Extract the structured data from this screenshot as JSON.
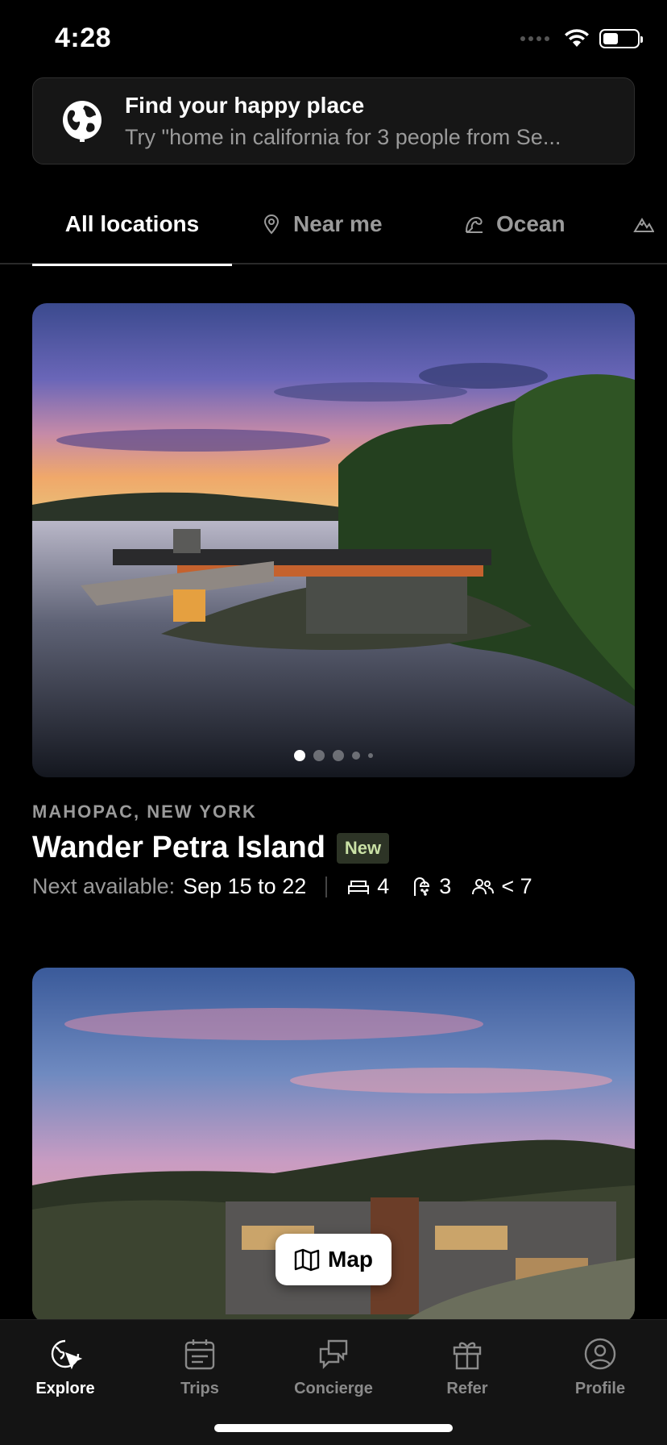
{
  "status_bar": {
    "time": "4:28",
    "battery_level": 0.45
  },
  "search": {
    "title": "Find your happy place",
    "placeholder": "Try \"home in california for 3 people from Se..."
  },
  "tabs": [
    {
      "label": "All locations",
      "active": true,
      "icon": ""
    },
    {
      "label": "Near me",
      "active": false,
      "icon": "location-pin-icon"
    },
    {
      "label": "Ocean",
      "active": false,
      "icon": "ocean-wave-icon"
    },
    {
      "label": "",
      "active": false,
      "icon": "mountain-icon"
    }
  ],
  "listings": [
    {
      "location": "MAHOPAC, NEW YORK",
      "name": "Wander Petra Island",
      "badge": "New",
      "availability_label": "Next available:",
      "availability_dates": "Sep 15 to 22",
      "bedrooms": "4",
      "bathrooms": "3",
      "guests": "< 7",
      "photo_count": 5,
      "photo_index": 1
    }
  ],
  "map_button": {
    "label": "Map"
  },
  "nav": {
    "items": [
      {
        "label": "Explore",
        "icon": "explore-icon",
        "active": true
      },
      {
        "label": "Trips",
        "icon": "calendar-icon",
        "active": false
      },
      {
        "label": "Concierge",
        "icon": "chat-bubbles-icon",
        "active": false
      },
      {
        "label": "Refer",
        "icon": "gift-icon",
        "active": false
      },
      {
        "label": "Profile",
        "icon": "user-circle-icon",
        "active": false
      }
    ]
  },
  "colors": {
    "background": "#000000",
    "badge_bg": "#2d3426",
    "badge_text": "#c9e0a5",
    "muted_text": "#9a9a9a"
  }
}
